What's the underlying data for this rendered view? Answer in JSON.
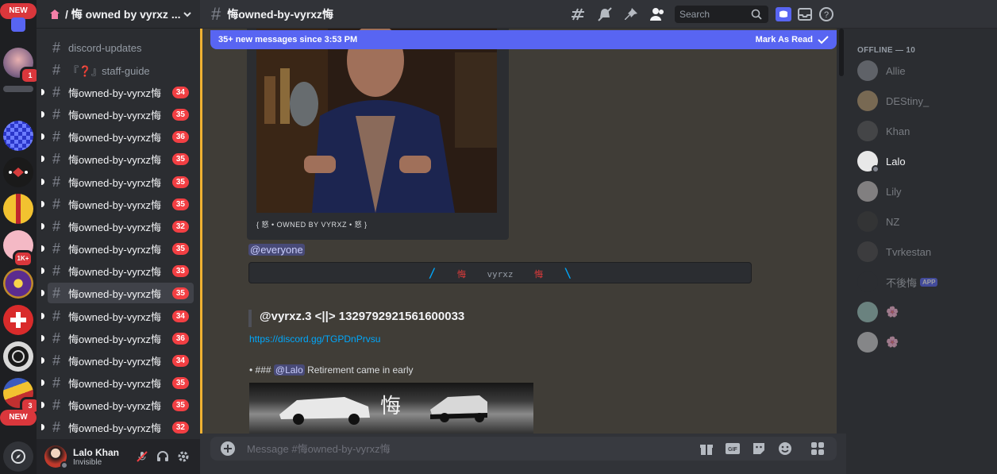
{
  "rail": {
    "new_top": "NEW",
    "new_bottom": "NEW",
    "badge_1": "1",
    "badge_1k": "1K+",
    "badge_3": "3"
  },
  "sidebar": {
    "guild_name": "/ 悔 owned by vyrxz ...",
    "channels": [
      {
        "name": "discord-updates",
        "count": ""
      },
      {
        "name": "『❓』staff-guide",
        "count": ""
      },
      {
        "name": "悔owned-by-vyrxz悔",
        "count": "34"
      },
      {
        "name": "悔owned-by-vyrxz悔",
        "count": "35"
      },
      {
        "name": "悔owned-by-vyrxz悔",
        "count": "36"
      },
      {
        "name": "悔owned-by-vyrxz悔",
        "count": "35"
      },
      {
        "name": "悔owned-by-vyrxz悔",
        "count": "35"
      },
      {
        "name": "悔owned-by-vyrxz悔",
        "count": "35"
      },
      {
        "name": "悔owned-by-vyrxz悔",
        "count": "32"
      },
      {
        "name": "悔owned-by-vyrxz悔",
        "count": "35"
      },
      {
        "name": "悔owned-by-vyrxz悔",
        "count": "33"
      },
      {
        "name": "悔owned-by-vyrxz悔",
        "count": "35"
      },
      {
        "name": "悔owned-by-vyrxz悔",
        "count": "34"
      },
      {
        "name": "悔owned-by-vyrxz悔",
        "count": "36"
      },
      {
        "name": "悔owned-by-vyrxz悔",
        "count": "34"
      },
      {
        "name": "悔owned-by-vyrxz悔",
        "count": "35"
      },
      {
        "name": "悔owned-by-vyrxz悔",
        "count": "35"
      },
      {
        "name": "悔owned-by-vyrxz悔",
        "count": "32"
      }
    ],
    "user": {
      "name": "Lalo Khan",
      "status": "Invisible"
    }
  },
  "chat": {
    "channel_title": "悔owned-by-vyrxz悔",
    "search_placeholder": "Search",
    "new_messages": "35+ new messages since 3:53 PM",
    "mark_as_read": "Mark As Read",
    "embed_footer": "{ 怒 • OWNED BY VYRXZ • 怒 }",
    "everyone": "@everyone",
    "codeblock": {
      "slash_left": "/",
      "kanji_left": "悔",
      "text": "vyrxz",
      "kanji_right": "悔",
      "slash_right": "\\"
    },
    "quote": "@vyrxz.3 <||> 1329792921561600033",
    "invite_link": "https://discord.gg/TGPDnPrvsu",
    "bullet_prefix": "### ",
    "bullet_mention": "@Lalo",
    "bullet_text": " Retirement came in early",
    "image_kanji": "悔",
    "composer_placeholder": "Message #悔owned-by-vyrxz悔"
  },
  "members": {
    "group_label": "OFFLINE — 10",
    "list": [
      {
        "name": "Allie",
        "app": ""
      },
      {
        "name": "DEStiny_",
        "app": ""
      },
      {
        "name": "Khan",
        "app": ""
      },
      {
        "name": "Lalo",
        "app": ""
      },
      {
        "name": "Lily",
        "app": ""
      },
      {
        "name": "NZ",
        "app": ""
      },
      {
        "name": "Tvrkestan",
        "app": ""
      },
      {
        "name": "不後悔",
        "app": "APP"
      },
      {
        "name": "🌸",
        "app": ""
      },
      {
        "name": "🌸",
        "app": ""
      }
    ]
  },
  "colors": {
    "blurple": "#5865f2",
    "danger": "#f23f43",
    "link": "#00a8fc"
  }
}
